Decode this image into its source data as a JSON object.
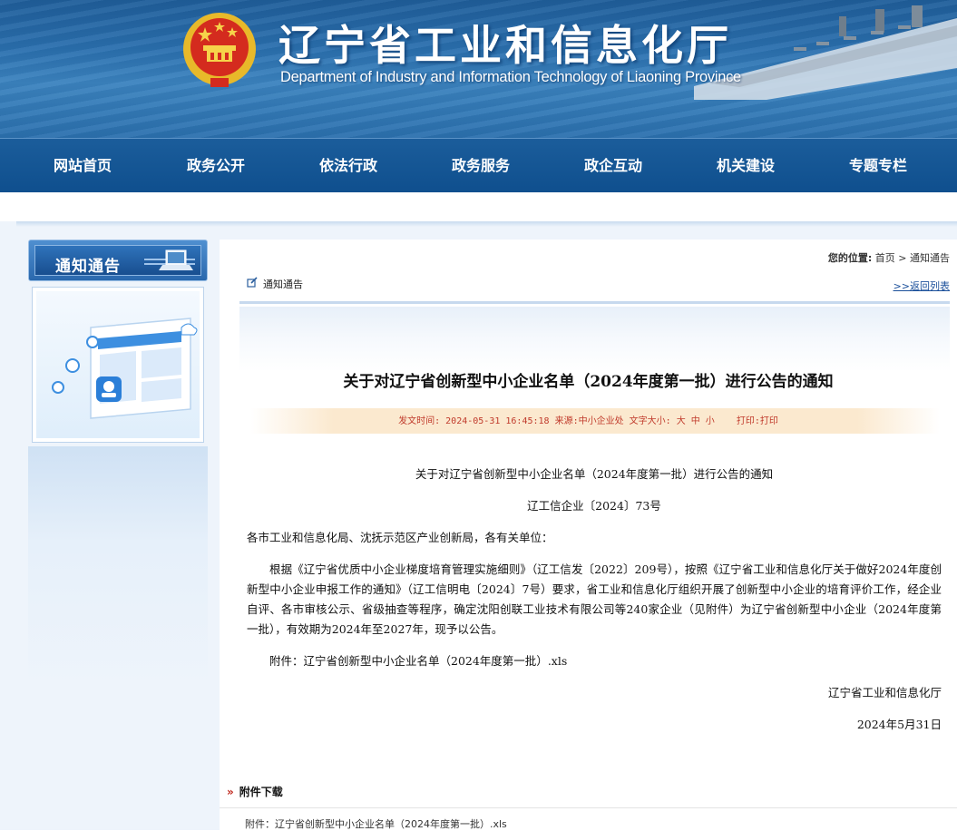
{
  "header": {
    "title_cn": "辽宁省工业和信息化厅",
    "title_en": "Department of Industry and Information Technology of Liaoning Province"
  },
  "nav": {
    "items": [
      "网站首页",
      "政务公开",
      "依法行政",
      "政务服务",
      "政企互动",
      "机关建设",
      "专题专栏"
    ]
  },
  "sidebar": {
    "title": "通知通告"
  },
  "breadcrumb": {
    "label": "您的位置:",
    "home": "首页",
    "sep": ">",
    "current": "通知通告"
  },
  "section": {
    "label": "通知通告",
    "back": ">>返回列表"
  },
  "article": {
    "title": "关于对辽宁省创新型中小企业名单（2024年度第一批）进行公告的通知",
    "meta_date_label": "发文时间:",
    "meta_date": "2024-05-31 16:45:18",
    "meta_source_label": "来源:",
    "meta_source": "中小企业处",
    "meta_size_label": "文字大小:",
    "meta_size_large": "大",
    "meta_size_medium": "中",
    "meta_size_small": "小",
    "meta_print_label": "打印:",
    "meta_print": "打印",
    "body_title": "关于对辽宁省创新型中小企业名单（2024年度第一批）进行公告的通知",
    "doc_number": "辽工信企业〔2024〕73号",
    "salutation": "各市工业和信息化局、沈抚示范区产业创新局，各有关单位：",
    "paragraph": "根据《辽宁省优质中小企业梯度培育管理实施细则》（辽工信发〔2022〕209号），按照《辽宁省工业和信息化厅关于做好2024年度创新型中小企业申报工作的通知》（辽工信明电〔2024〕7号）要求，省工业和信息化厅组织开展了创新型中小企业的培育评价工作，经企业自评、各市审核公示、省级抽查等程序，确定沈阳创联工业技术有限公司等240家企业（见附件）为辽宁省创新型中小企业（2024年度第一批），有效期为2024年至2027年，现予以公告。",
    "attachment_line": "附件：辽宁省创新型中小企业名单（2024年度第一批）.xls",
    "signature": "辽宁省工业和信息化厅",
    "date": "2024年5月31日"
  },
  "attachments": {
    "heading_arrow": "»",
    "heading": "附件下载",
    "link": "附件：辽宁省创新型中小企业名单（2024年度第一批）.xls"
  },
  "colors": {
    "nav_bg": "#0f4f8e",
    "meta_text": "#c03a2b",
    "link": "#1a4f9a"
  }
}
